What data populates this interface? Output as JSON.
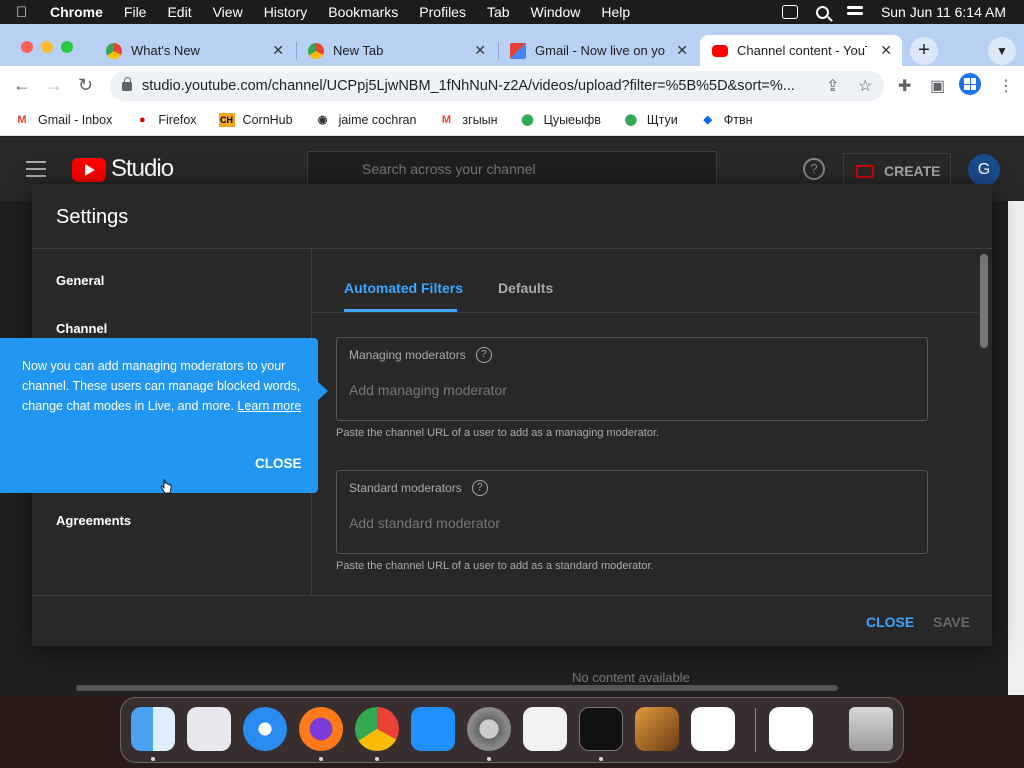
{
  "menubar": {
    "app_name": "Chrome",
    "items": [
      "File",
      "Edit",
      "View",
      "History",
      "Bookmarks",
      "Profiles",
      "Tab",
      "Window",
      "Help"
    ],
    "datetime": "Sun Jun 11  6:14 AM"
  },
  "tabs": [
    {
      "title": "What's New",
      "icon": "chrome-icon"
    },
    {
      "title": "New Tab",
      "icon": "chrome-icon"
    },
    {
      "title": "Gmail - Now live on your",
      "icon": "gmail-icon"
    },
    {
      "title": "Channel content - YouTu",
      "icon": "youtube-icon"
    }
  ],
  "toolbar": {
    "url": "studio.youtube.com/channel/UCPpj5LjwNBM_1fNhNuN-z2A/videos/upload?filter=%5B%5D&sort=%..."
  },
  "bookmarks": [
    {
      "label": "Gmail - Inbox",
      "icon": "gmail-icon",
      "color": "#ea4335"
    },
    {
      "label": "Firefox",
      "icon": "redhat-icon",
      "color": "#cc0000"
    },
    {
      "label": "CornHub",
      "icon": "ch-icon",
      "color": "#f5a623"
    },
    {
      "label": "jaime cochran",
      "icon": "globe-icon",
      "color": "#333333"
    },
    {
      "label": "згыын",
      "icon": "gmail-icon",
      "color": "#ea4335"
    },
    {
      "label": "Цуыеыфв",
      "icon": "maps-icon",
      "color": "#34a853"
    },
    {
      "label": "Щтуи",
      "icon": "maps-icon",
      "color": "#34a853"
    },
    {
      "label": "Фтвн",
      "icon": "dropbox-icon",
      "color": "#0061ff"
    }
  ],
  "yt": {
    "studio_label": "Studio",
    "search_placeholder": "Search across your channel",
    "create_label": "CREATE",
    "avatar_letter": "G",
    "bg_text": "No content available"
  },
  "dialog": {
    "title": "Settings",
    "nav": [
      "General",
      "Channel",
      "Agreements"
    ],
    "tabs": [
      "Automated Filters",
      "Defaults"
    ],
    "managing": {
      "label": "Managing moderators",
      "placeholder": "Add managing moderator",
      "helper": "Paste the channel URL of a user to add as a managing moderator."
    },
    "standard": {
      "label": "Standard moderators",
      "placeholder": "Add standard moderator",
      "helper": "Paste the channel URL of a user to add as a standard moderator."
    },
    "close_label": "CLOSE",
    "save_label": "SAVE"
  },
  "tooltip": {
    "message": "Now you can add managing moderators to your channel. These users can manage blocked words, change chat modes in Live, and more.",
    "link": "Learn more",
    "close_label": "CLOSE"
  },
  "dock": [
    "finder",
    "launchpad",
    "safari",
    "firefox",
    "chrome",
    "app-store",
    "system-preferences",
    "textedit",
    "terminal",
    "garageband",
    "vscode",
    "visual-studio",
    "trash"
  ]
}
